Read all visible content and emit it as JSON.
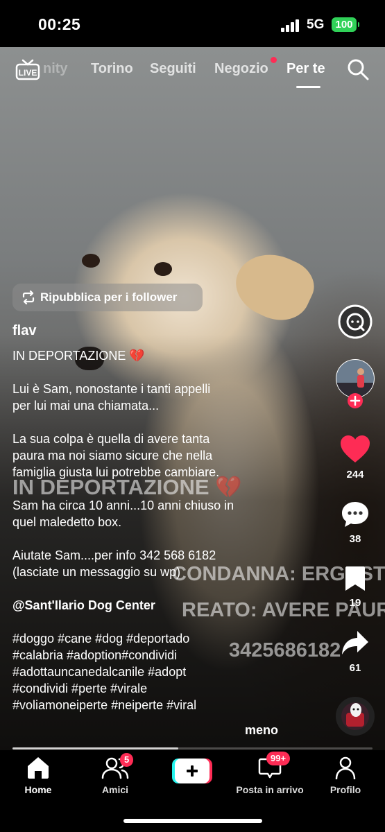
{
  "status_bar": {
    "time": "00:25",
    "network": "5G",
    "battery": "100"
  },
  "top_nav": {
    "tabs": [
      "nity",
      "Torino",
      "Seguiti",
      "Negozio",
      "Per te"
    ],
    "active_tab": "Per te"
  },
  "video_overlay": {
    "title": "IN DEPORTAZIONE 💔",
    "line1": "CONDANNA: ERGASTOLO.",
    "line2": "REATO: AVERE PAURA.",
    "line3": "3425686182"
  },
  "repost": {
    "label": "Ripubblica per i follower"
  },
  "caption": {
    "username": "flav",
    "title": "IN DEPORTAZIONE 💔",
    "para1": [
      "Lui è Sam, nonostante i tanti appelli",
      "per lui mai una chiamata..."
    ],
    "para2": [
      "La sua colpa è quella di avere tanta",
      "paura ma noi siamo sicure che nella",
      "famiglia giusta lui potrebbe cambiare."
    ],
    "para3": [
      "Sam ha circa 10 anni...10 anni chiuso in",
      "quel maledetto box."
    ],
    "para4": [
      "Aiutate Sam....per info 342 568 6182",
      "(lasciate un messaggio su wp)"
    ],
    "mention": "@Sant'Ilario Dog Center",
    "hashtags": [
      "#doggo #cane #dog #deportado",
      "#calabria #adoption#condividi",
      "#adottauncanedalcanile #adopt",
      "#condividi #perte #virale",
      "#voliamoneiperte #neiperte #viral"
    ],
    "more": "meno"
  },
  "actions": {
    "likes": "244",
    "comments": "38",
    "saves": "19",
    "shares": "61"
  },
  "progress": {
    "fraction": 0.46
  },
  "bottom_nav": {
    "items": [
      "Home",
      "Amici",
      "Posta in arrivo",
      "Profilo"
    ],
    "friends_badge": "5",
    "inbox_badge": "99+",
    "active": "Home"
  },
  "colors": {
    "accent": "#fe2c55",
    "battery": "#30d158"
  }
}
